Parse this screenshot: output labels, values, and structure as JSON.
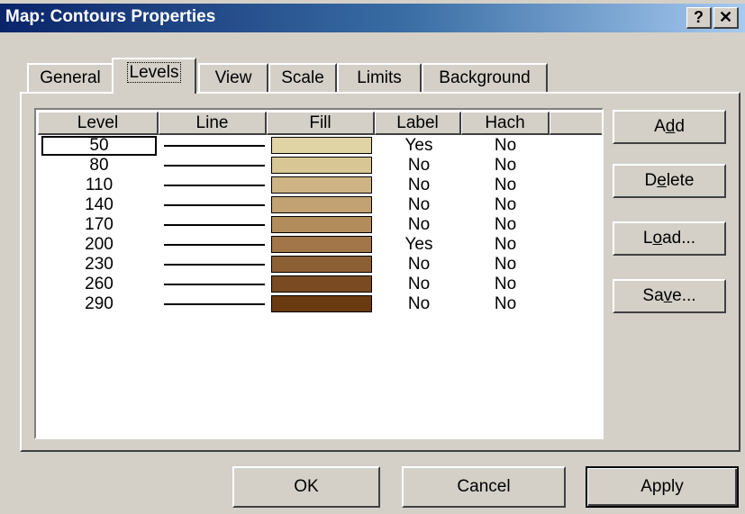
{
  "window": {
    "title": "Map: Contours Properties"
  },
  "titlebar": {
    "help_glyph": "?",
    "close_glyph": "✕",
    "help_icon": "help-question-icon",
    "close_icon": "close-x-icon"
  },
  "tabs": [
    {
      "label": "General"
    },
    {
      "label": "Levels",
      "active": true
    },
    {
      "label": "View"
    },
    {
      "label": "Scale"
    },
    {
      "label": "Limits"
    },
    {
      "label": "Background"
    }
  ],
  "list": {
    "columns": [
      "Level",
      "Line",
      "Fill",
      "Label",
      "Hach",
      ""
    ],
    "rows": [
      {
        "level": "50",
        "label": "Yes",
        "hach": "No",
        "fill": "#e0d4a4",
        "selected": true
      },
      {
        "level": "80",
        "label": "No",
        "hach": "No",
        "fill": "#d8c694"
      },
      {
        "level": "110",
        "label": "No",
        "hach": "No",
        "fill": "#ceb484"
      },
      {
        "level": "140",
        "label": "No",
        "hach": "No",
        "fill": "#c2a272"
      },
      {
        "level": "170",
        "label": "No",
        "hach": "No",
        "fill": "#b38c5c"
      },
      {
        "level": "200",
        "label": "Yes",
        "hach": "No",
        "fill": "#a27649"
      },
      {
        "level": "230",
        "label": "No",
        "hach": "No",
        "fill": "#8d5f35"
      },
      {
        "level": "260",
        "label": "No",
        "hach": "No",
        "fill": "#7a4a22"
      },
      {
        "level": "290",
        "label": "No",
        "hach": "No",
        "fill": "#6a3a10"
      }
    ]
  },
  "side_buttons": [
    {
      "pre": "A",
      "u": "d",
      "post": "d"
    },
    {
      "pre": "D",
      "u": "e",
      "post": "lete"
    },
    {
      "pre": "L",
      "u": "o",
      "post": "ad..."
    },
    {
      "pre": "Sa",
      "u": "v",
      "post": "e..."
    }
  ],
  "bottom_buttons": {
    "ok": "OK",
    "cancel": "Cancel",
    "apply": "Apply"
  }
}
